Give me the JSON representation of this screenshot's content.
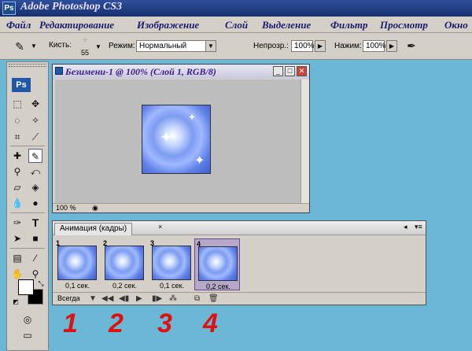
{
  "app": {
    "title": "Adobe Photoshop CS3",
    "logo": "Ps"
  },
  "menu": [
    "Файл",
    "Редактирование",
    "Изображение",
    "Слой",
    "Выделение",
    "Фильтр",
    "Просмотр",
    "Окно"
  ],
  "options": {
    "brush_label": "Кисть:",
    "brush_size": "55",
    "mode_label": "Режим:",
    "mode_value": "Нормальный",
    "opacity_label": "Непрозр.:",
    "opacity_value": "100%",
    "flow_label": "Нажим:",
    "flow_value": "100%"
  },
  "toolbox": {
    "logo": "Ps"
  },
  "document": {
    "title": "Безимени-1 @ 100% (Слой 1, RGB/8)",
    "zoom": "100 %"
  },
  "animation": {
    "tab": "Анимация (кадры)",
    "frames": [
      {
        "num": "1",
        "delay": "0,1 сек."
      },
      {
        "num": "2",
        "delay": "0,2 сек."
      },
      {
        "num": "3",
        "delay": "0,1 сек."
      },
      {
        "num": "4",
        "delay": "0,2 сек."
      }
    ],
    "loop": "Всегда"
  },
  "annotations": [
    "1",
    "2",
    "3",
    "4"
  ],
  "colors": {
    "annotation": "#e01010",
    "desktop": "#6ab7d6",
    "title_bar": "#16306e"
  }
}
